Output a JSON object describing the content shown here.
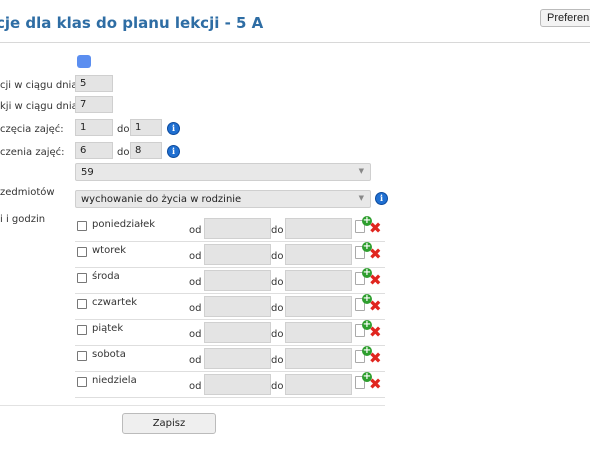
{
  "header": {
    "title": "cje dla klas do planu lekcji - 5 A",
    "preferences_label": "Preferen"
  },
  "form": {
    "color_label": "",
    "lessons_per_day_label": "cji w ciągu dnia:",
    "lessons_per_day_value": "5",
    "max_lessons_per_day_label": "kji w ciągu dnia:",
    "max_lessons_per_day_value": "7",
    "start_label": "częcia zajęć:",
    "start_from": "1",
    "start_to_label": "do",
    "start_to": "1",
    "end_label": "czenia zajęć:",
    "end_from": "6",
    "end_to_label": "do",
    "end_to": "8",
    "room_value": "59",
    "subjects_label": "zedmiotów",
    "subject_selected": "wychowanie do życia w rodzinie",
    "days_label": "i i godzin"
  },
  "days": [
    {
      "name": "poniedziałek",
      "from_label": "od",
      "to_label": "do"
    },
    {
      "name": "wtorek",
      "from_label": "od",
      "to_label": "do"
    },
    {
      "name": "środa",
      "from_label": "od",
      "to_label": "do"
    },
    {
      "name": "czwartek",
      "from_label": "od",
      "to_label": "do"
    },
    {
      "name": "piątek",
      "from_label": "od",
      "to_label": "do"
    },
    {
      "name": "sobota",
      "from_label": "od",
      "to_label": "do"
    },
    {
      "name": "niedziela",
      "from_label": "od",
      "to_label": "do"
    }
  ],
  "icons": {
    "info": "i",
    "add": "+",
    "delete": "✖",
    "caret": "▼"
  },
  "colors": {
    "title": "#2e6da4",
    "swatch": "#5b8ef0",
    "add_icon": "#2e9e2e",
    "delete_icon": "#e0261f",
    "info_icon": "#1f6fd1"
  },
  "actions": {
    "save_label": "Zapisz"
  }
}
